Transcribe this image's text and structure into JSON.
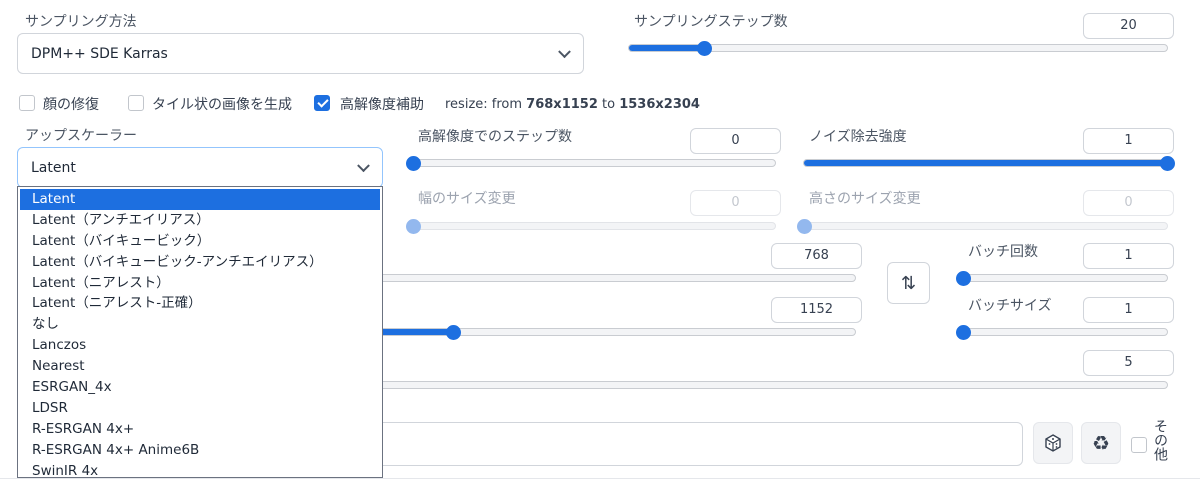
{
  "sampling": {
    "method_label": "サンプリング方法",
    "method_value": "DPM++ SDE Karras",
    "steps_label": "サンプリングステップ数",
    "steps_value": "20",
    "steps_level": 0.14
  },
  "options": {
    "face_restore": "顔の修復",
    "tiling": "タイル状の画像を生成",
    "hires_fix": "高解像度補助",
    "face_restore_checked": false,
    "tiling_checked": false,
    "hires_fix_checked": true
  },
  "resize_info": {
    "prefix": "resize: from ",
    "from": "768x1152",
    "mid": " to ",
    "to": "1536x2304"
  },
  "upscaler": {
    "label": "アップスケーラー",
    "value": "Latent",
    "options": [
      "Latent",
      "Latent（アンチエイリアス）",
      "Latent（バイキュービック）",
      "Latent（バイキュービック-アンチエイリアス）",
      "Latent（ニアレスト）",
      "Latent（ニアレスト-正確）",
      "なし",
      "Lanczos",
      "Nearest",
      "ESRGAN_4x",
      "LDSR",
      "R-ESRGAN 4x+",
      "R-ESRGAN 4x+ Anime6B",
      "SwinIR 4x"
    ]
  },
  "hires_steps": {
    "label": "高解像度でのステップ数",
    "value": "0",
    "level": 0.0
  },
  "denoise": {
    "label": "ノイズ除去強度",
    "value": "1",
    "level": 1.0
  },
  "resize_width": {
    "label": "幅のサイズ変更",
    "value": "0",
    "level": 0.0
  },
  "resize_height": {
    "label": "高さのサイズ変更",
    "value": "0",
    "level": 0.0
  },
  "width": {
    "value": "768"
  },
  "height": {
    "value": "1152",
    "level": 0.17
  },
  "swap_button": "⇅",
  "batch_count": {
    "label": "バッチ回数",
    "value": "1",
    "level": 0.0
  },
  "batch_size": {
    "label": "バッチサイズ",
    "value": "1",
    "level": 0.0
  },
  "cfg": {
    "value": "5"
  },
  "seed": {
    "dice_icon": "dice-icon",
    "recycle_icon": "recycle-icon",
    "extra_label": "その他"
  },
  "colors": {
    "accent": "#1d6fe0",
    "accent_disabled": "#93b8ee"
  }
}
